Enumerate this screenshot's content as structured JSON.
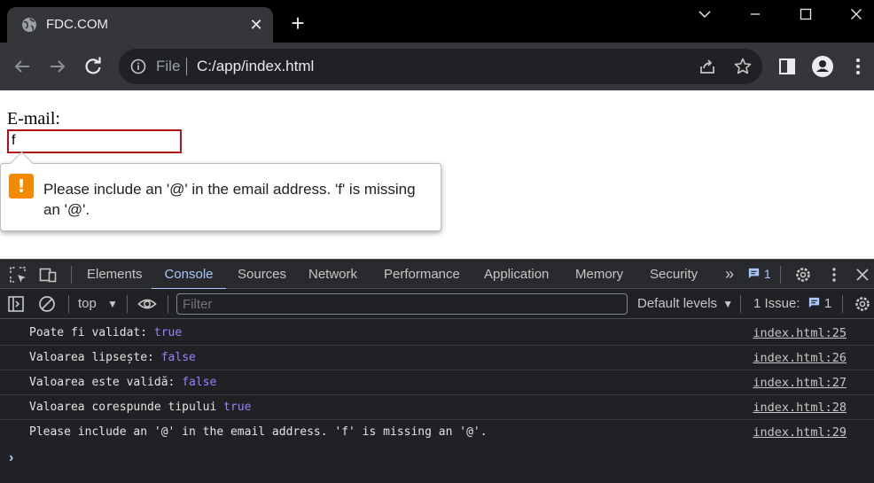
{
  "browser": {
    "tab": {
      "title": "FDC.COM",
      "close_glyph": "✕",
      "favicon": "globe-icon"
    },
    "new_tab_glyph": "+",
    "window_controls": [
      "chevron-down-icon",
      "minimize-icon",
      "maximize-icon",
      "close-icon"
    ],
    "omnibox": {
      "scheme": "File",
      "url": "C:/app/index.html"
    }
  },
  "page": {
    "email_label": "E-mail:",
    "email_value": "f",
    "validation": {
      "icon_glyph": "!",
      "message": "Please include an '@' in the email address. 'f' is missing an '@'."
    }
  },
  "devtools": {
    "tabs": [
      "Elements",
      "Console",
      "Sources",
      "Network",
      "Performance",
      "Application",
      "Memory",
      "Security"
    ],
    "active_tab": "Console",
    "more_tabs_glyph": "»",
    "issue_count": "1",
    "context": "top",
    "filter_placeholder": "Filter",
    "levels_label": "Default levels",
    "issues_label": "1 Issue:",
    "issues_count": "1",
    "logs": [
      {
        "text": "Poate fi validat: ",
        "value": "true",
        "source": "index.html:25"
      },
      {
        "text": "Valoarea lipsește: ",
        "value": "false",
        "source": "index.html:26"
      },
      {
        "text": "Valoarea este validă: ",
        "value": "false",
        "source": "index.html:27"
      },
      {
        "text": "Valoarea corespunde tipului ",
        "value": "true",
        "source": "index.html:28"
      },
      {
        "text": "Please include an '@' in the email address. 'f' is missing an '@'.",
        "value": "",
        "source": "index.html:29"
      }
    ],
    "prompt_glyph": "›"
  },
  "colors": {
    "accent": "#a8c7fa",
    "console_value": "#9980ff",
    "invalid_border": "#b21212",
    "warning_orange": "#f28a00"
  }
}
